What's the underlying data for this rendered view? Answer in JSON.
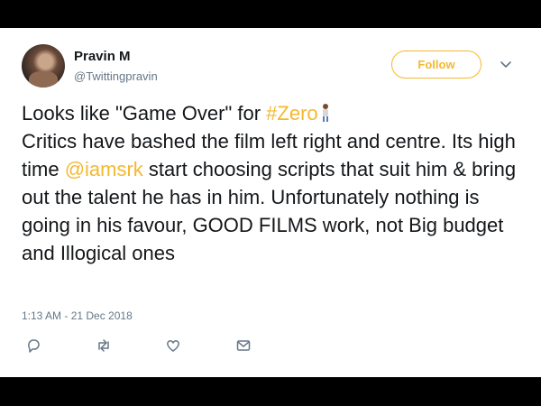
{
  "user": {
    "name": "Pravin M",
    "handle": "@Twittingpravin"
  },
  "follow_label": "Follow",
  "tweet": {
    "line1_prefix": "Looks like \"Game Over\" for ",
    "hashtag": "#Zero",
    "line2_prefix": "Critics have bashed the film left right and centre. Its high time ",
    "mention": "@iamsrk",
    "line2_suffix": " start choosing scripts that suit him & bring out the talent he has in him. Unfortunately nothing is going in his favour, GOOD FILMS work, not Big budget and Illogical ones"
  },
  "timestamp": "1:13 AM - 21 Dec 2018",
  "icons": {
    "reply": "reply-icon",
    "retweet": "retweet-icon",
    "like": "heart-icon",
    "dm": "envelope-icon",
    "more": "chevron-down-icon"
  },
  "colors": {
    "accent": "#f5b82e",
    "text": "#14171a",
    "muted": "#657786"
  }
}
